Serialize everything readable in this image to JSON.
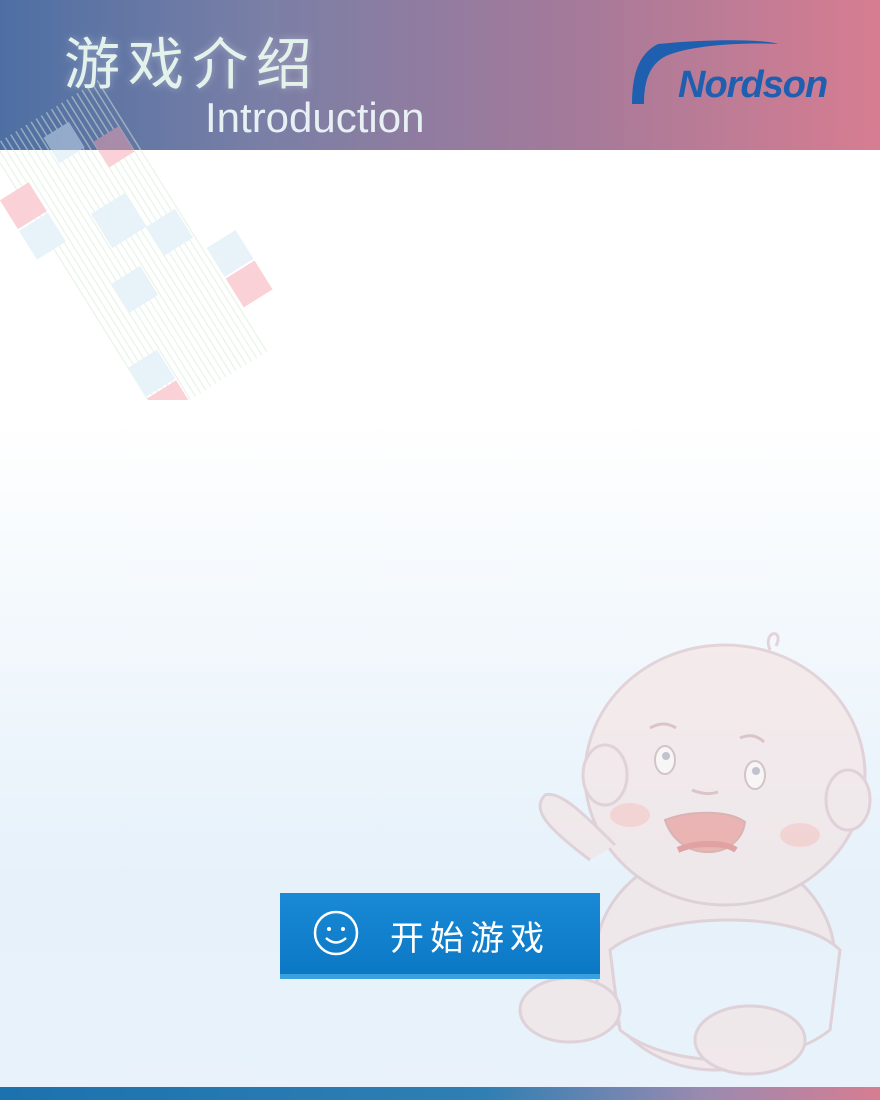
{
  "header": {
    "title_cn": "游戏介绍",
    "title_en": "Introduction",
    "logo_text": "Nordson"
  },
  "start_button": {
    "label": "开始游戏",
    "icon": "smiley-icon"
  },
  "colors": {
    "header_start": "#4e6fa3",
    "header_end": "#d77d91",
    "button": "#0b78c4",
    "logo_blue": "#1f5fb0"
  }
}
